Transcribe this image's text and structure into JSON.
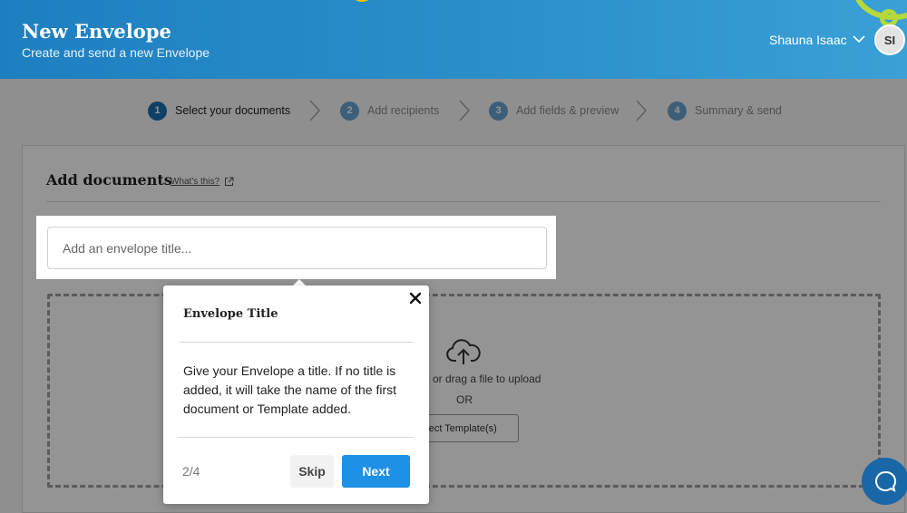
{
  "header": {
    "title": "New Envelope",
    "subtitle": "Create and send a new Envelope",
    "user_name": "Shauna Isaac",
    "avatar_initials": "SI"
  },
  "stepper": {
    "steps": [
      {
        "number": "1",
        "label": "Select your documents",
        "active": true
      },
      {
        "number": "2",
        "label": "Add recipients",
        "active": false
      },
      {
        "number": "3",
        "label": "Add fields & preview",
        "active": false
      },
      {
        "number": "4",
        "label": "Summary & send",
        "active": false
      }
    ]
  },
  "documents": {
    "section_title": "Add documents",
    "whats_this": "What's this?",
    "title_placeholder": "Add an envelope title...",
    "upload_text": "e or drag a file to upload",
    "or_text": "OR",
    "template_button": "elect Template(s)"
  },
  "tooltip": {
    "title": "Envelope Title",
    "body": "Give your Envelope a title. If no title is added, it will take the name of the first document or Template added.",
    "counter": "2/4",
    "skip_label": "Skip",
    "next_label": "Next"
  },
  "colors": {
    "header_blue": "#2a8fcb",
    "step_active": "#1a6fb0",
    "next_button": "#1e90e6",
    "help_bubble": "#1a67a8"
  }
}
